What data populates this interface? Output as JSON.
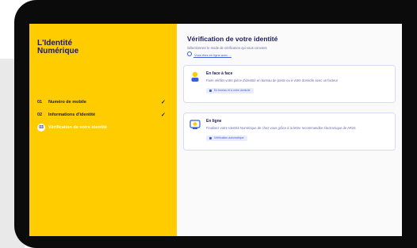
{
  "logo": {
    "line1": "L'Identité",
    "line2": "Numérique"
  },
  "steps": [
    {
      "number": "01",
      "label": "Numéro de mobile",
      "status": "done"
    },
    {
      "number": "02",
      "label": "Informations d'identité",
      "status": "done"
    },
    {
      "number": "03",
      "label": "Vérification de votre identité",
      "status": "active"
    }
  ],
  "main": {
    "title": "Vérification de votre identité",
    "subtitle": "Sélectionnez le mode de vérification qui vous convient",
    "help_link": "Vous êtes en ligne avec ...",
    "options": [
      {
        "heading": "En face à face",
        "description": "Faire vérifier votre pièce d'identité en bureau de poste ou à votre domicile avec un facteur",
        "badge": "En bureau et à votre domicile",
        "icon": "person-icon"
      },
      {
        "heading": "En ligne",
        "description": "Finalisez votre Identité Numérique de chez vous grâce à la lettre recommandée électronique de AR24",
        "badge": "Vérification automatique",
        "icon": "online-icon"
      }
    ]
  },
  "colors": {
    "sidebar": "#ffcc00",
    "navy": "#1b1b5e",
    "accent": "#3b5bdb"
  }
}
